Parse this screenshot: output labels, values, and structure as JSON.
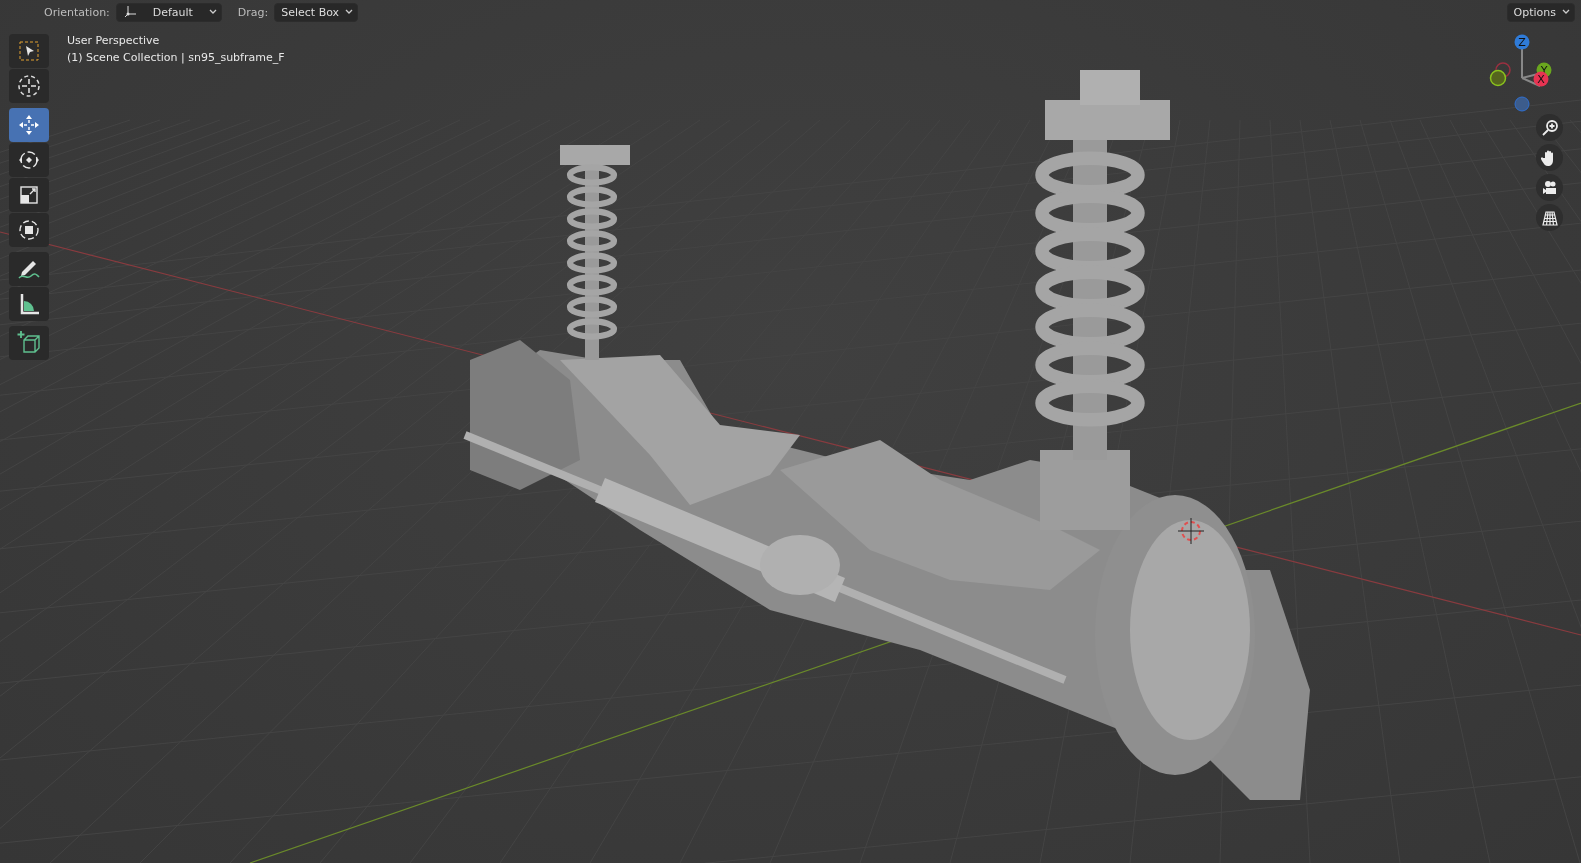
{
  "header": {
    "orientation_label": "Orientation:",
    "orientation_value": "Default",
    "drag_label": "Drag:",
    "drag_value": "Select Box",
    "options": "Options"
  },
  "viewport": {
    "view_name": "User Perspective",
    "collection_info": "(1) Scene Collection | sn95_subframe_F"
  },
  "tool_groups": [
    [
      {
        "kind": "select_box",
        "selected": false
      },
      {
        "kind": "cursor",
        "selected": false
      }
    ],
    [
      {
        "kind": "move",
        "selected": true
      },
      {
        "kind": "rotate",
        "selected": false
      },
      {
        "kind": "scale",
        "selected": false
      },
      {
        "kind": "transform",
        "selected": false
      }
    ],
    [
      {
        "kind": "annotate",
        "selected": false
      },
      {
        "kind": "measure",
        "selected": false
      }
    ],
    [
      {
        "kind": "add_cube",
        "selected": false
      }
    ]
  ],
  "gizmo": {
    "z": "Z",
    "y": "Y",
    "x": "X"
  },
  "navigation": [
    {
      "kind": "zoom"
    },
    {
      "kind": "pan"
    },
    {
      "kind": "camera"
    },
    {
      "kind": "ortho"
    }
  ]
}
